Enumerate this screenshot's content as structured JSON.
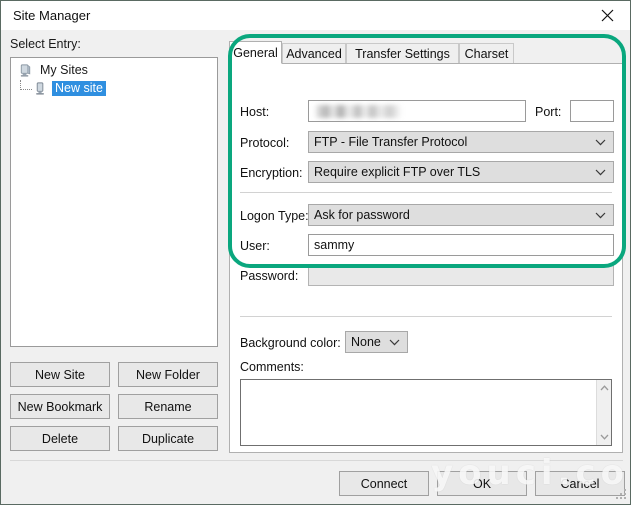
{
  "window": {
    "title": "Site Manager",
    "close_icon": "close-icon"
  },
  "left": {
    "select_entry_label": "Select Entry:",
    "tree": [
      {
        "label": "My Sites",
        "icon": "server-icon",
        "selected": false
      },
      {
        "label": "New site",
        "icon": "server-icon",
        "selected": true
      }
    ],
    "buttons": [
      {
        "label": "New Site"
      },
      {
        "label": "New Folder"
      },
      {
        "label": "New Bookmark"
      },
      {
        "label": "Rename"
      },
      {
        "label": "Delete"
      },
      {
        "label": "Duplicate"
      }
    ]
  },
  "tabs": [
    {
      "label": "General",
      "active": true
    },
    {
      "label": "Advanced",
      "active": false
    },
    {
      "label": "Transfer Settings",
      "active": false
    },
    {
      "label": "Charset",
      "active": false
    }
  ],
  "general": {
    "host_label": "Host:",
    "host_value": "",
    "host_redacted": true,
    "port_label": "Port:",
    "port_value": "",
    "protocol_label": "Protocol:",
    "protocol_value": "FTP - File Transfer Protocol",
    "encryption_label": "Encryption:",
    "encryption_value": "Require explicit FTP over TLS",
    "logon_type_label": "Logon Type:",
    "logon_type_value": "Ask for password",
    "user_label": "User:",
    "user_value": "sammy",
    "password_label": "Password:",
    "password_value": "",
    "background_color_label": "Background color:",
    "background_color_value": "None",
    "comments_label": "Comments:",
    "comments_value": ""
  },
  "bottom_buttons": [
    {
      "label": "Connect"
    },
    {
      "label": "OK"
    },
    {
      "label": "Cancel"
    }
  ],
  "watermark": "youci.com",
  "colors": {
    "highlight": "#0aa77e",
    "selection": "#2f8fe0",
    "dialog_bg": "#f0f0f0",
    "field_disabled": "#e9e9e9",
    "combo_bg": "#dedede"
  }
}
